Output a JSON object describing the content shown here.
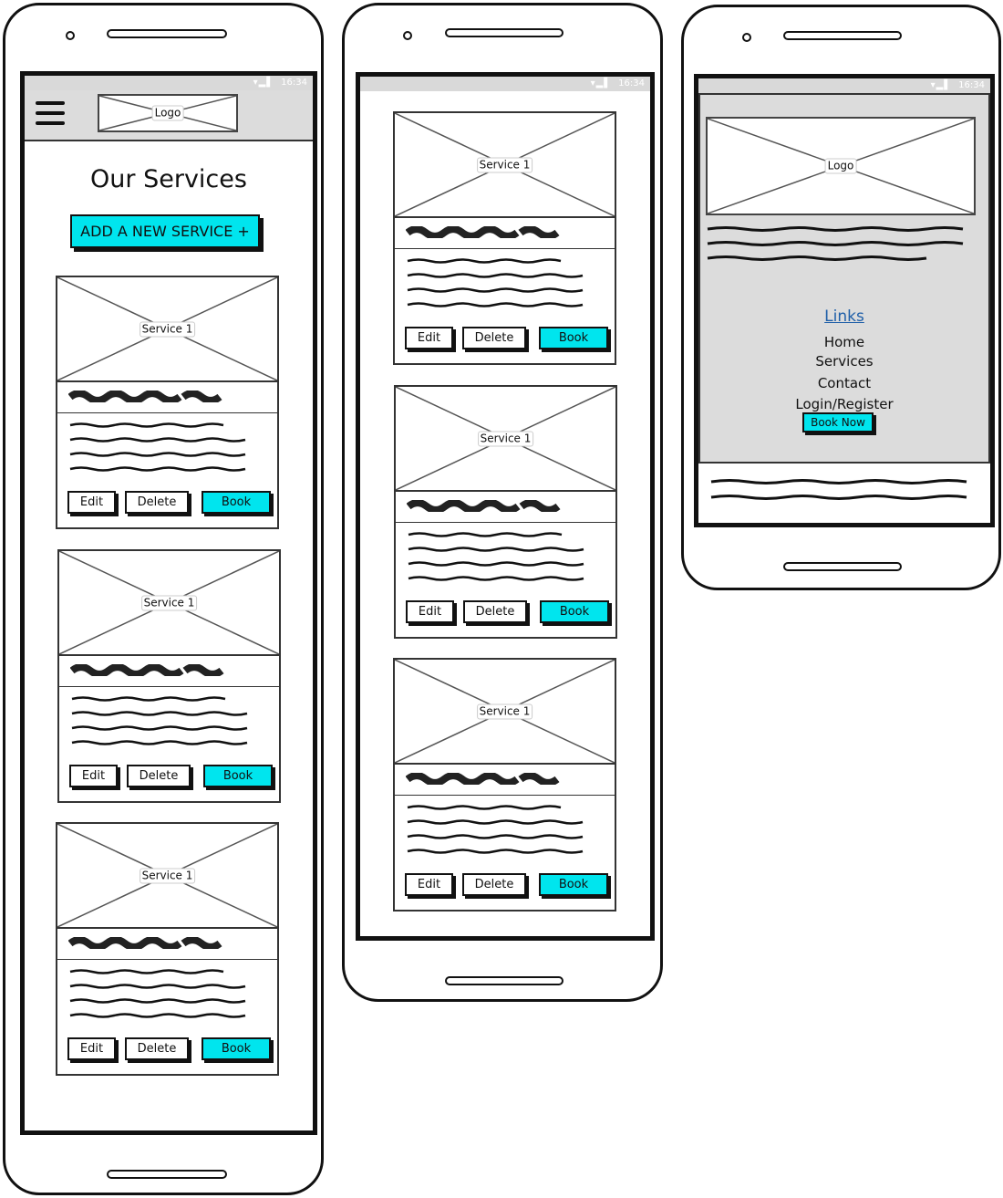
{
  "status_bar": {
    "time": "16:34",
    "icons": "wifi signal battery"
  },
  "header": {
    "menu_icon": "hamburger-icon",
    "logo_label": "Logo"
  },
  "services_page": {
    "title": "Our Services",
    "add_button_label": "ADD A NEW SERVICE +"
  },
  "service_card": {
    "image_label": "Service 1",
    "edit_label": "Edit",
    "delete_label": "Delete",
    "book_label": "Book"
  },
  "nav_menu": {
    "logo_label": "Logo",
    "links_heading": "Links",
    "items": [
      "Home",
      "Services",
      "Contact",
      "Login/Register"
    ],
    "book_now_label": "Book Now"
  },
  "colors": {
    "accent": "#00e5ee",
    "link": "#1f5fa8",
    "panel": "#dcdcdc"
  }
}
